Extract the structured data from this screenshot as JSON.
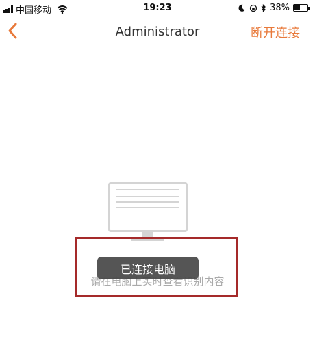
{
  "status_bar": {
    "carrier": "中国移动",
    "time": "19:23",
    "battery_percent": "38%"
  },
  "nav": {
    "title": "Administrator",
    "disconnect_label": "断开连接",
    "accent_color": "#e8793a"
  },
  "main": {
    "toast_text": "已连接电脑",
    "hint_text": "请在电脑上实时查看识别内容"
  }
}
